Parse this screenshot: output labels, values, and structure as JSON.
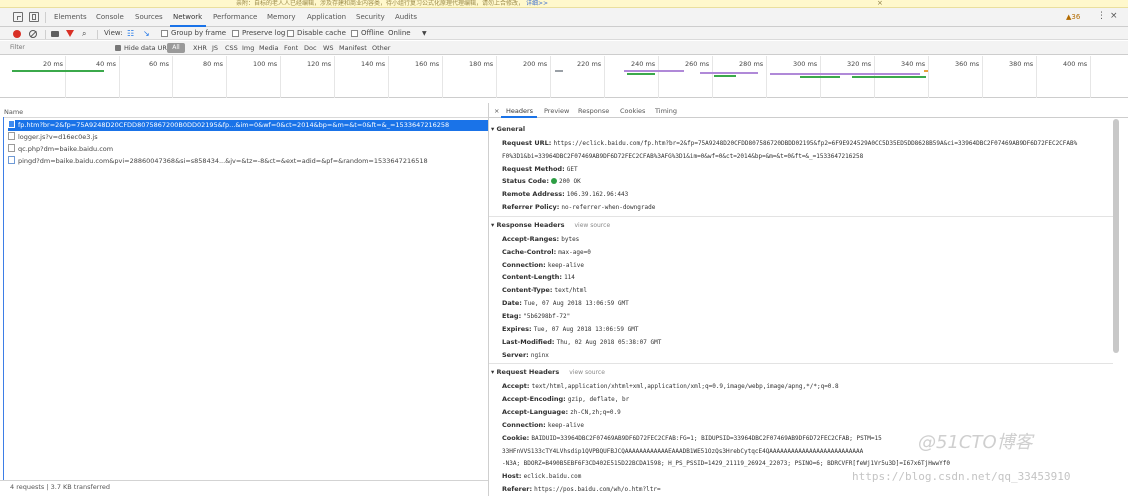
{
  "notification": {
    "text": "亲附：自标的老人人已经编辑，涉及存建和商业内容类，待小组行复习公式化原理代理编辑，请勿上合修改，",
    "link": "详细>>",
    "close": "×"
  },
  "tabs": [
    "Elements",
    "Console",
    "Sources",
    "Network",
    "Performance",
    "Memory",
    "Application",
    "Security",
    "Audits"
  ],
  "active_tab": "Network",
  "warning_count": "▲36",
  "kebab": "⋮",
  "close_devtools": "×",
  "toolbar": {
    "view_label": "View:",
    "group_by_frame": "Group by frame",
    "preserve_log": "Preserve log",
    "disable_cache": "Disable cache",
    "offline": "Offline",
    "throttle": "Online",
    "throttle_caret": "▼"
  },
  "filterbar": {
    "placeholder": "Filter",
    "hide_data_urls": "Hide data URLs",
    "types": [
      "All",
      "XHR",
      "JS",
      "CSS",
      "Img",
      "Media",
      "Font",
      "Doc",
      "WS",
      "Manifest",
      "Other"
    ]
  },
  "timeline_ticks": [
    "20 ms",
    "40 ms",
    "60 ms",
    "80 ms",
    "100 ms",
    "120 ms",
    "140 ms",
    "160 ms",
    "180 ms",
    "200 ms",
    "220 ms",
    "240 ms",
    "260 ms",
    "280 ms",
    "300 ms",
    "320 ms",
    "340 ms",
    "360 ms",
    "380 ms",
    "400 ms"
  ],
  "request_list": {
    "header": "Name",
    "rows": [
      "fp.htm?br=2&fp=75A9248D20CFDD8075867200B0DD02195&fp...&im=0&wf=0&ct=2014&bp=&m=&t=0&ft=&_=1533647216258",
      "logger.js?v=d16ec0e3.js",
      "qc.php?dm=baike.baidu.com",
      "pingd?dm=baike.baidu.com&pvi=28860047368&si=s858434...&jv=&tz=-8&ct=&ext=adid=&pf=&random=1533647216518"
    ]
  },
  "status_bar": "4 requests | 3.7 KB transferred",
  "detail": {
    "close": "×",
    "tabs": [
      "Headers",
      "Preview",
      "Response",
      "Cookies",
      "Timing"
    ],
    "view_source": "view source",
    "general": {
      "title": "General",
      "request_url_label": "Request URL:",
      "request_url": "https://eclick.baidu.com/fp.htm?br=2&fp=75A9248D20CFDD807586720DBDD02195&fp2=6F9E924529A0CC5D35ED5DD8628B59A&ci=33964DBC2F07469AB9DF6D72FEC2CFAB%",
      "request_url_2": "F0%3D1&bi=33964DBC2F07469AB9DF6D72FEC2CFAB%3AFG%3D1&im=0&wf=0&ct=2014&bp=&m=&t=0&ft=&_=1533647216258",
      "request_method_label": "Request Method:",
      "request_method": "GET",
      "status_code_label": "Status Code:",
      "status_code": "200 OK",
      "remote_address_label": "Remote Address:",
      "remote_address": "106.39.162.96:443",
      "referrer_policy_label": "Referrer Policy:",
      "referrer_policy": "no-referrer-when-downgrade"
    },
    "response_headers": {
      "title": "Response Headers",
      "items": [
        {
          "k": "Accept-Ranges:",
          "v": "bytes"
        },
        {
          "k": "Cache-Control:",
          "v": "max-age=0"
        },
        {
          "k": "Connection:",
          "v": "keep-alive"
        },
        {
          "k": "Content-Length:",
          "v": "114"
        },
        {
          "k": "Content-Type:",
          "v": "text/html"
        },
        {
          "k": "Date:",
          "v": "Tue, 07 Aug 2018 13:06:59 GMT"
        },
        {
          "k": "Etag:",
          "v": "\"5b6298bf-72\""
        },
        {
          "k": "Expires:",
          "v": "Tue, 07 Aug 2018 13:06:59 GMT"
        },
        {
          "k": "Last-Modified:",
          "v": "Thu, 02 Aug 2018 05:38:07 GMT"
        },
        {
          "k": "Server:",
          "v": "nginx"
        }
      ]
    },
    "request_headers": {
      "title": "Request Headers",
      "items": [
        {
          "k": "Accept:",
          "v": "text/html,application/xhtml+xml,application/xml;q=0.9,image/webp,image/apng,*/*;q=0.8"
        },
        {
          "k": "Accept-Encoding:",
          "v": "gzip, deflate, br"
        },
        {
          "k": "Accept-Language:",
          "v": "zh-CN,zh;q=0.9"
        },
        {
          "k": "Connection:",
          "v": "keep-alive"
        },
        {
          "k": "Cookie:",
          "v": "BAIDUID=33964DBC2F07469AB9DF6D72FEC2CFAB:FG=1; BIDUPSID=33964DBC2F07469AB9DF6D72FEC2CFAB; PSTM=15"
        },
        {
          "k": "",
          "v": "33HFnVVS133cTY4LVhsdip1QVPBQUFBJCQAAAAAAAAAAAAEAAADB1WE51OzQs3HrebCytqcE4QAAAAAAAAAAAAAAAAAAAAAAAAAA"
        },
        {
          "k": "",
          "v": "-N3A; BDORZ=B490B5EBF6F3CD402E515D22BCDA1598; H_PS_PSSID=1429_21119_26924_22073; PSINO=6; BDRCVFR[feWj1Vr5u3D]=I67x6TjHwwYf0"
        },
        {
          "k": "Host:",
          "v": "eclick.baidu.com"
        },
        {
          "k": "Referer:",
          "v": "https://pos.baidu.com/wh/o.htm?ltr="
        }
      ]
    }
  },
  "watermark": {
    "url": "https://blog.csdn.net/qq_33453910",
    "logo": "@51CTO博客"
  }
}
